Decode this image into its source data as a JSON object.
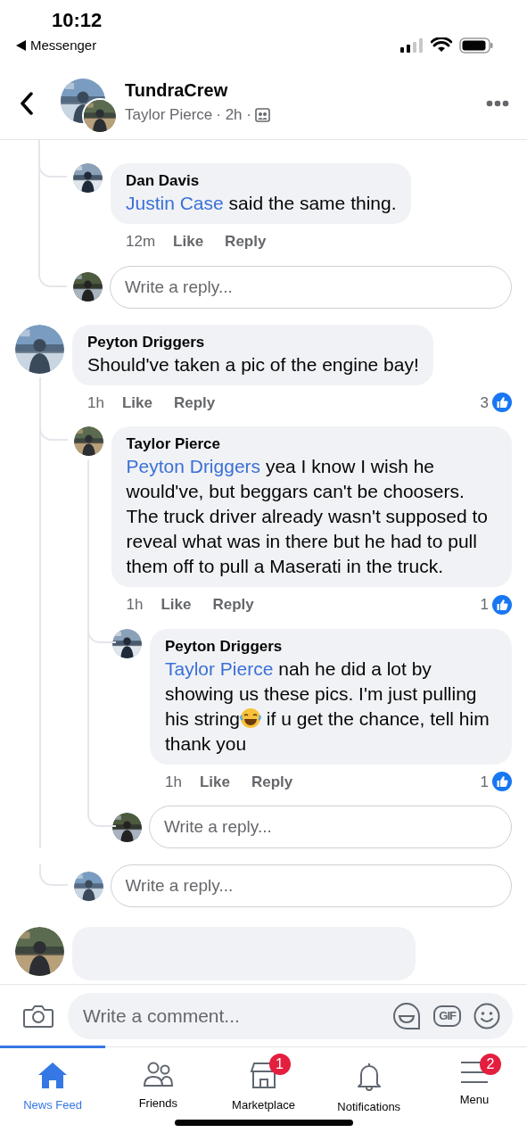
{
  "status_bar": {
    "time": "10:12",
    "back_app": "Messenger"
  },
  "header": {
    "title": "TundraCrew",
    "author": "Taylor Pierce",
    "meta": " · 2h ·"
  },
  "thread": [
    {
      "kind": "continuation",
      "children": [
        {
          "kind": "comment",
          "author": "Dan Davis",
          "body": [
            {
              "kind": "mention",
              "text": "Justin Case"
            },
            {
              "kind": "text",
              "text": " said the same thing."
            }
          ],
          "time": "12m",
          "like": "Like",
          "reply": "Reply"
        },
        {
          "kind": "reply_box",
          "placeholder": "Write a reply..."
        }
      ]
    },
    {
      "kind": "comment",
      "author": "Peyton Driggers",
      "body": [
        {
          "kind": "text",
          "text": "Should've taken a pic of the engine bay!"
        }
      ],
      "time": "1h",
      "like": "Like",
      "reply": "Reply",
      "reactions": "3",
      "children": [
        {
          "kind": "comment",
          "author": "Taylor Pierce",
          "body": [
            {
              "kind": "mention",
              "text": "Peyton Driggers"
            },
            {
              "kind": "text",
              "text": " yea I know I wish he would've, but beggars can't be choosers. The truck driver already wasn't supposed to reveal what was in there but he had to pull them off to pull a Maserati in the truck."
            }
          ],
          "time": "1h",
          "like": "Like",
          "reply": "Reply",
          "reactions": "1",
          "children": [
            {
              "kind": "comment",
              "author": "Peyton Driggers",
              "body": [
                {
                  "kind": "mention",
                  "text": "Taylor Pierce"
                },
                {
                  "kind": "text",
                  "text": " nah he did a lot by showing us these pics. I'm just pulling his string"
                },
                {
                  "kind": "emoji"
                },
                {
                  "kind": "text",
                  "text": " if u get the chance, tell him thank you"
                }
              ],
              "time": "1h",
              "like": "Like",
              "reply": "Reply",
              "reactions": "1"
            },
            {
              "kind": "reply_box",
              "placeholder": "Write a reply..."
            }
          ]
        },
        {
          "kind": "reply_box",
          "placeholder": "Write a reply..."
        }
      ]
    },
    {
      "kind": "cut_comment"
    }
  ],
  "composer": {
    "placeholder": "Write a comment...",
    "gif": "GIF"
  },
  "tabs": [
    {
      "label": "News Feed",
      "selected": true
    },
    {
      "label": "Friends",
      "selected": false
    },
    {
      "label": "Marketplace",
      "selected": false,
      "badge": "1"
    },
    {
      "label": "Notifications",
      "selected": false
    },
    {
      "label": "Menu",
      "selected": false,
      "badge": "2"
    }
  ]
}
